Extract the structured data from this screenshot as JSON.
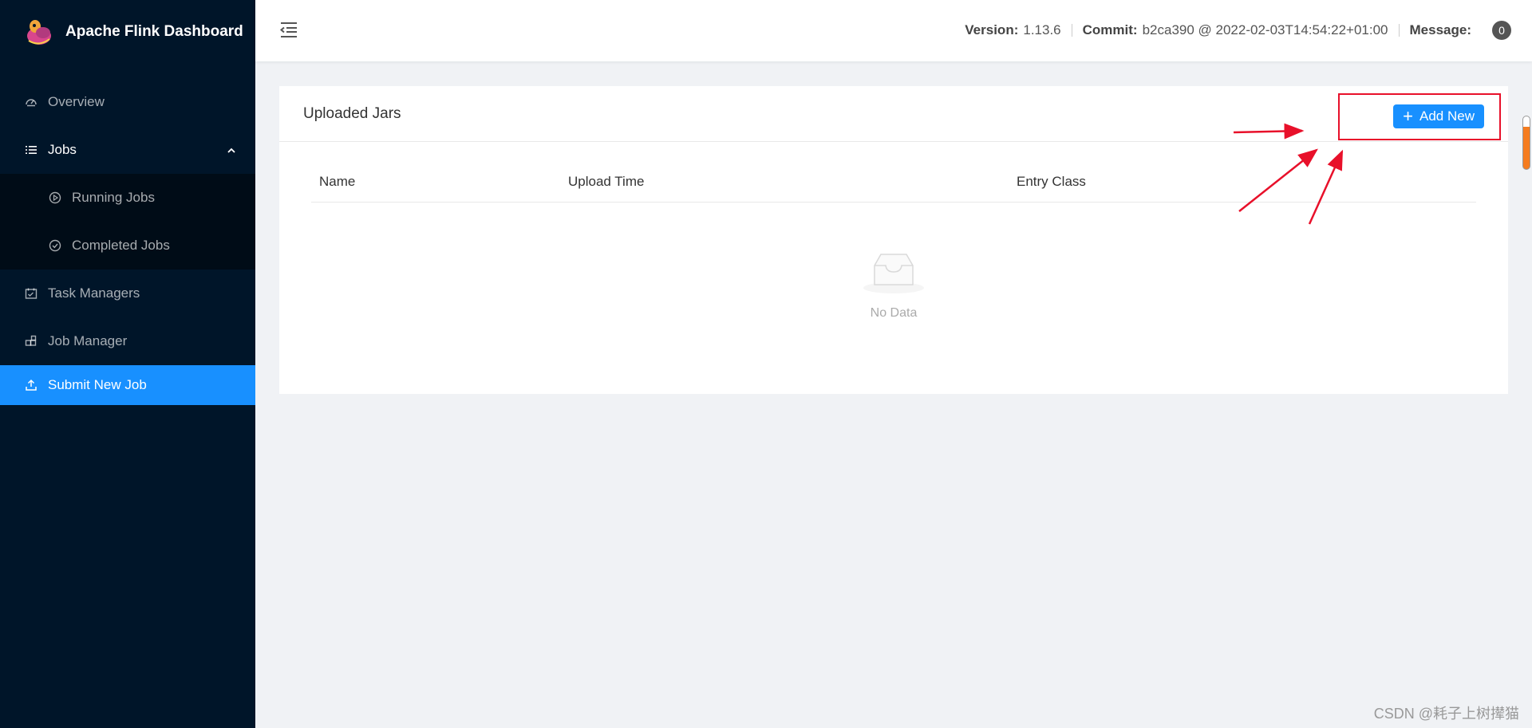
{
  "app": {
    "title": "Apache Flink Dashboard"
  },
  "sidebar": {
    "items": [
      {
        "label": "Overview",
        "icon": "dashboard-icon"
      },
      {
        "label": "Jobs",
        "icon": "list-icon",
        "expanded": true,
        "children": [
          {
            "label": "Running Jobs",
            "icon": "play-circle-icon"
          },
          {
            "label": "Completed Jobs",
            "icon": "check-circle-icon"
          }
        ]
      },
      {
        "label": "Task Managers",
        "icon": "schedule-icon"
      },
      {
        "label": "Job Manager",
        "icon": "build-icon"
      },
      {
        "label": "Submit New Job",
        "icon": "upload-icon",
        "selected": true
      }
    ],
    "selected_color": "#1890ff"
  },
  "header": {
    "version_label": "Version:",
    "version_value": "1.13.6",
    "commit_label": "Commit:",
    "commit_value": "b2ca390 @ 2022-02-03T14:54:22+01:00",
    "message_label": "Message:",
    "message_count": "0"
  },
  "card": {
    "title": "Uploaded Jars",
    "add_button_label": "Add New",
    "columns": [
      "Name",
      "Upload Time",
      "Entry Class"
    ],
    "rows": [],
    "empty_text": "No Data"
  },
  "watermark": "CSDN @耗子上树撵猫",
  "colors": {
    "primary": "#1890ff",
    "sidebar": "#001529",
    "annotation": "#e8102a"
  }
}
